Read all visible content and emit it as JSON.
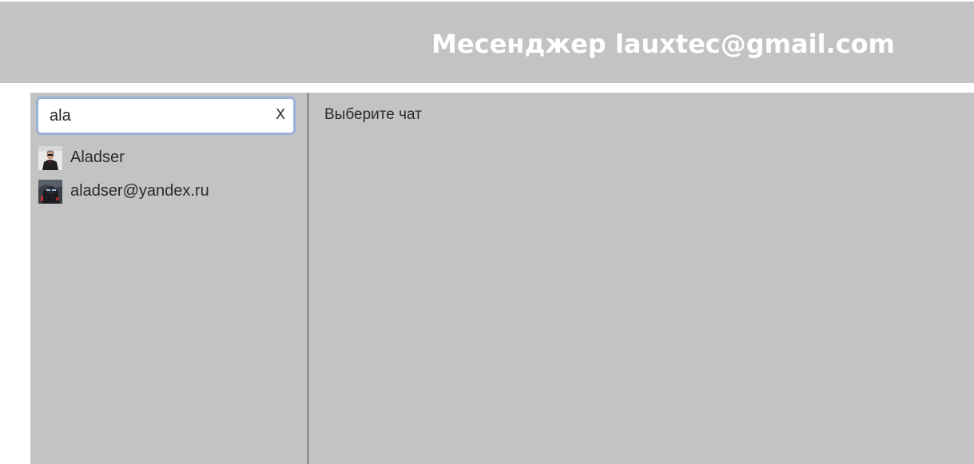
{
  "header": {
    "title": "Месенджер lauxtec@gmail.com"
  },
  "search": {
    "value": "ala",
    "clear_label": "X"
  },
  "results": [
    {
      "label": "Aladser",
      "avatar_icon": "man-portrait-avatar-icon"
    },
    {
      "label": "aladser@yandex.ru",
      "avatar_icon": "dark-figure-avatar-icon"
    }
  ],
  "main": {
    "empty_message": "Выберите чат"
  },
  "colors": {
    "panel_background": "#c3c3c3",
    "header_text": "#ffffff",
    "search_focus_border": "#9ab2d8",
    "divider": "#3a3a3a"
  }
}
